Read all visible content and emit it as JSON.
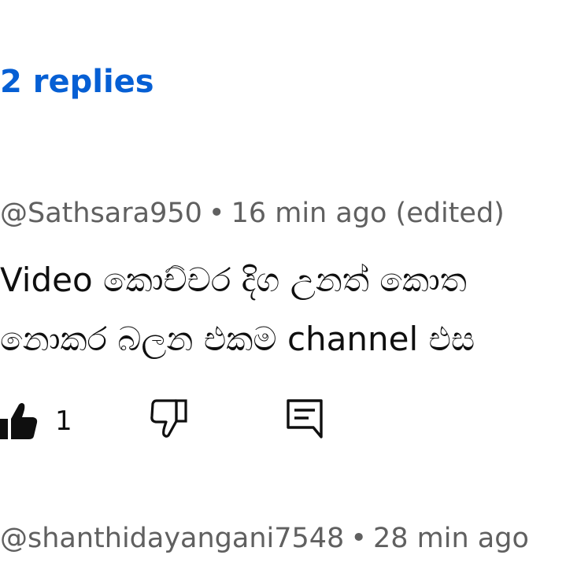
{
  "thread": {
    "replies_label": "2 replies"
  },
  "comment1": {
    "author": "@Sathsara950",
    "separator": "•",
    "time": "16 min ago (edited)",
    "text_lines": [
      "Video කොච්චර දිග උනත් කොත",
      "නොකර බලන එකම channel එස"
    ],
    "like_count": "1",
    "icons": {
      "like": "thumbs-up-filled-icon",
      "dislike": "thumbs-down-outline-icon",
      "reply": "reply-comment-icon"
    }
  },
  "comment2": {
    "author": "@shanthidayangani7548",
    "separator": "•",
    "time": "28 min ago"
  },
  "colors": {
    "link": "#065fd4",
    "meta": "#606060",
    "text": "#0f0f0f"
  }
}
